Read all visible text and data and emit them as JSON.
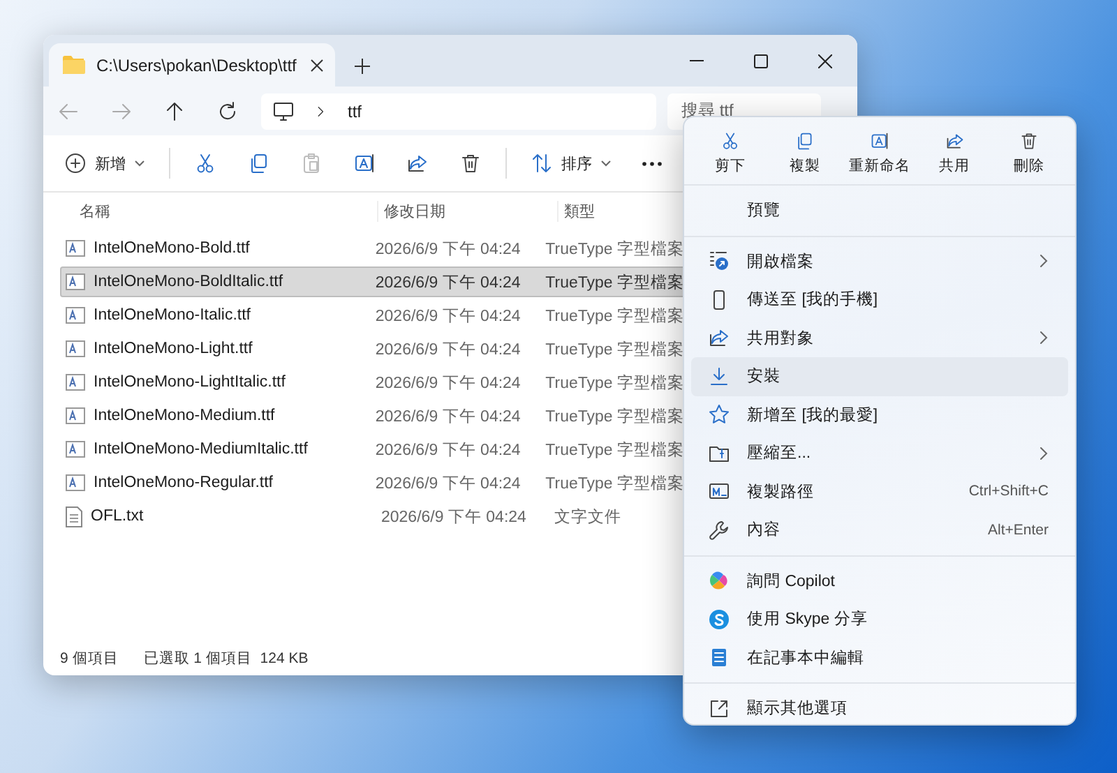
{
  "explorer": {
    "tab_title": "C:\\Users\\pokan\\Desktop\\ttf",
    "breadcrumb": "ttf",
    "search": {
      "placeholder": "搜尋 ttf"
    },
    "toolbar": [
      {
        "kind": "new",
        "label": "新增",
        "disabled": false
      },
      {
        "kind": "cut",
        "disabled": false
      },
      {
        "kind": "copy",
        "disabled": false
      },
      {
        "kind": "paste",
        "disabled": true
      },
      {
        "kind": "rename",
        "disabled": false
      },
      {
        "kind": "share",
        "disabled": false
      },
      {
        "kind": "delete",
        "disabled": false
      },
      {
        "kind": "sort",
        "label": "排序",
        "disabled": false
      },
      {
        "kind": "more",
        "disabled": false
      }
    ],
    "columns": [
      "名稱",
      "修改日期",
      "類型"
    ],
    "rows": [
      {
        "kind": "font",
        "name": "IntelOneMono-Bold.ttf",
        "date": "2026/6/9 下午 04:24",
        "type": "TrueType 字型檔案",
        "selected": false
      },
      {
        "kind": "font",
        "name": "IntelOneMono-BoldItalic.ttf",
        "date": "2026/6/9 下午 04:24",
        "type": "TrueType 字型檔案",
        "selected": true
      },
      {
        "kind": "font",
        "name": "IntelOneMono-Italic.ttf",
        "date": "2026/6/9 下午 04:24",
        "type": "TrueType 字型檔案",
        "selected": false
      },
      {
        "kind": "font",
        "name": "IntelOneMono-Light.ttf",
        "date": "2026/6/9 下午 04:24",
        "type": "TrueType 字型檔案",
        "selected": false
      },
      {
        "kind": "font",
        "name": "IntelOneMono-LightItalic.ttf",
        "date": "2026/6/9 下午 04:24",
        "type": "TrueType 字型檔案",
        "selected": false
      },
      {
        "kind": "font",
        "name": "IntelOneMono-Medium.ttf",
        "date": "2026/6/9 下午 04:24",
        "type": "TrueType 字型檔案",
        "selected": false
      },
      {
        "kind": "font",
        "name": "IntelOneMono-MediumItalic.ttf",
        "date": "2026/6/9 下午 04:24",
        "type": "TrueType 字型檔案",
        "selected": false
      },
      {
        "kind": "font",
        "name": "IntelOneMono-Regular.ttf",
        "date": "2026/6/9 下午 04:24",
        "type": "TrueType 字型檔案",
        "selected": false
      },
      {
        "kind": "text",
        "name": "OFL.txt",
        "date": "2026/6/9 下午 04:24",
        "type": "文字文件",
        "selected": false
      }
    ],
    "status": {
      "count": "9 個項目",
      "selection": "已選取 1 個項目  124 KB"
    }
  },
  "menu": {
    "actions": [
      {
        "kind": "cut",
        "label": "剪下"
      },
      {
        "kind": "copy",
        "label": "複製"
      },
      {
        "kind": "rename",
        "label": "重新命名"
      },
      {
        "kind": "share",
        "label": "共用"
      },
      {
        "kind": "delete",
        "label": "刪除"
      }
    ],
    "groups": [
      {
        "items": [
          {
            "kind": "none",
            "label": "預覽",
            "submenu": false,
            "selected": false
          }
        ]
      },
      {
        "items": [
          {
            "kind": "open",
            "label": "開啟檔案",
            "submenu": true,
            "selected": false
          },
          {
            "kind": "phone",
            "label": "傳送至 [我的手機]",
            "submenu": false,
            "selected": false
          },
          {
            "kind": "share",
            "label": "共用對象",
            "submenu": true,
            "selected": false
          },
          {
            "kind": "install",
            "label": "安裝",
            "submenu": false,
            "selected": true
          },
          {
            "kind": "star",
            "label": "新增至 [我的最愛]",
            "submenu": false,
            "selected": false
          },
          {
            "kind": "zip",
            "label": "壓縮至...",
            "submenu": true,
            "selected": false
          },
          {
            "kind": "path",
            "label": "複製路徑",
            "shortcut": "Ctrl+Shift+C",
            "submenu": false,
            "selected": false
          },
          {
            "kind": "wrench",
            "label": "內容",
            "shortcut": "Alt+Enter",
            "submenu": false,
            "selected": false
          }
        ]
      },
      {
        "items": [
          {
            "kind": "copilot",
            "label": "詢問 Copilot",
            "submenu": false,
            "selected": false
          },
          {
            "kind": "skype",
            "label": "使用 Skype 分享",
            "submenu": false,
            "selected": false
          },
          {
            "kind": "notepad",
            "label": "在記事本中編輯",
            "submenu": false,
            "selected": false
          }
        ]
      },
      {
        "items": [
          {
            "kind": "more",
            "label": "顯示其他選項",
            "submenu": false,
            "selected": false
          }
        ]
      }
    ]
  }
}
